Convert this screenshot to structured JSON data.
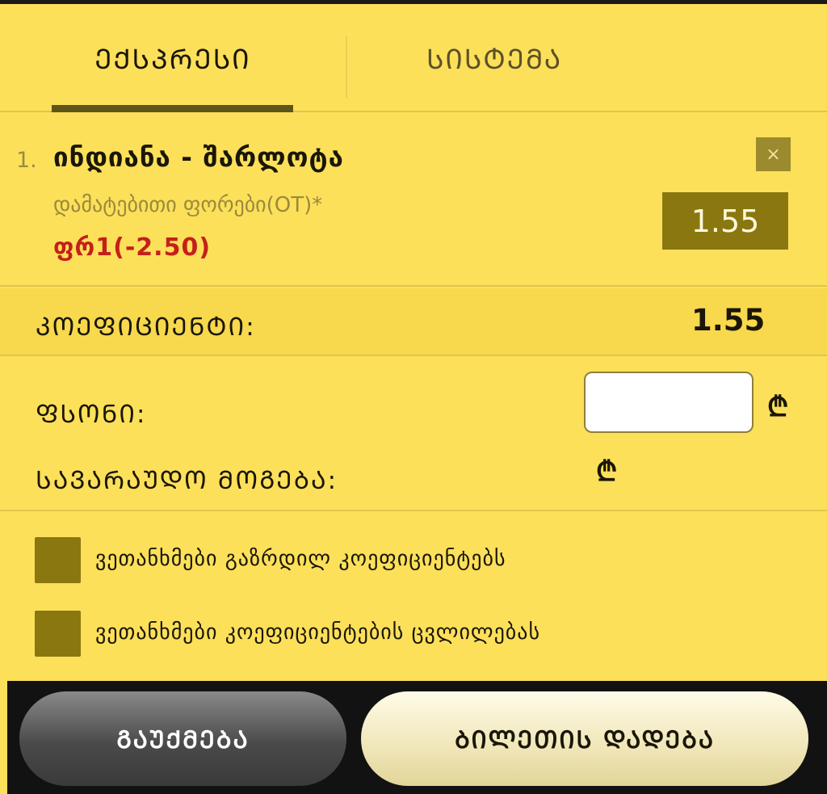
{
  "tabs": [
    {
      "label": "ᲔᲥᲡᲞᲠᲔᲡᲘ",
      "active": true
    },
    {
      "label": "ᲡᲘᲡᲢᲔᲛᲐ",
      "active": false
    }
  ],
  "bet": {
    "index": "1.",
    "title": "ინდიანა - შარლოტა",
    "market": "დამატებითი ფორები(OT)*",
    "selection": "ფრ1(-2.50)",
    "odds": "1.55",
    "remove_icon": "×"
  },
  "coefficient": {
    "label": "ᲙᲝᲔᲤᲘᲪᲘᲔᲜᲢᲘ:",
    "value": "1.55"
  },
  "stake": {
    "label": "ᲤᲡᲝᲜᲘ:",
    "value": "",
    "currency_symbol": "₾"
  },
  "potential_win": {
    "label": "ᲡᲐᲕᲐᲠᲐᲣᲓᲝ ᲛᲝᲒᲔᲑᲐ:",
    "value": "",
    "currency_symbol": "₾"
  },
  "options": [
    {
      "label": "ვეთანხმები გაზრდილ კოეფიციენტებს",
      "checked": false
    },
    {
      "label": "ვეთანხმები კოეფიციენტების ცვლილებას",
      "checked": false
    }
  ],
  "actions": {
    "cancel_label": "ᲒᲐᲣᲥᲛᲔᲑᲐ",
    "place_label": "ᲑᲘᲚᲔᲗᲘᲡ ᲓᲐᲓᲔᲑᲐ"
  },
  "colors": {
    "background": "#fde05a",
    "accent_dark": "#8a7710",
    "selection_red": "#c4201a"
  }
}
